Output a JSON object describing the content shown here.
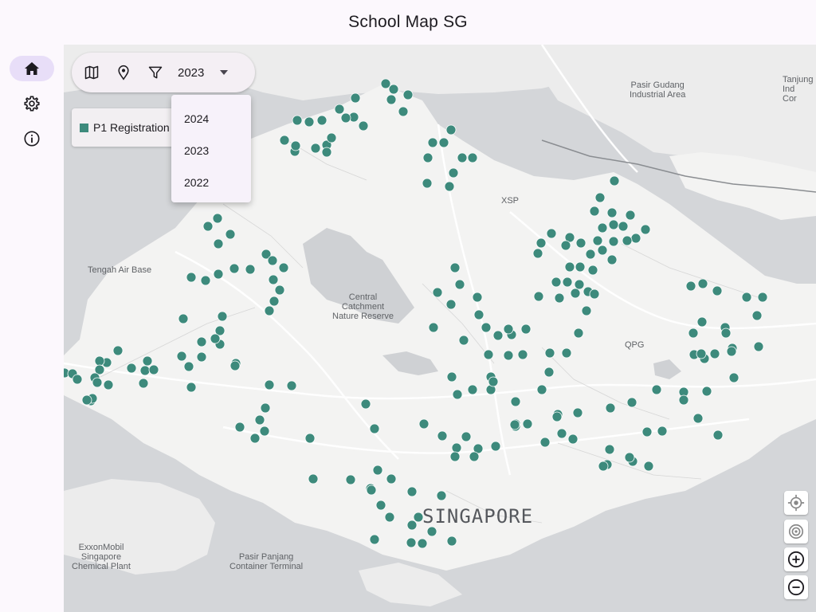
{
  "app": {
    "title": "School Map SG"
  },
  "rail": {
    "items": [
      {
        "name": "home",
        "icon": "home-icon",
        "active": true
      },
      {
        "name": "settings",
        "icon": "gear-icon",
        "active": false
      },
      {
        "name": "about",
        "icon": "info-icon",
        "active": false
      }
    ]
  },
  "toolbar": {
    "icons": [
      "map-icon",
      "location-pin-icon",
      "filter-icon"
    ],
    "year_selected": "2023",
    "year_options": [
      "2024",
      "2023",
      "2022"
    ]
  },
  "legend": {
    "label": "P1 Registration",
    "color": "#3d8a7c"
  },
  "map": {
    "labels": {
      "pasir_gudang": "Pasir Gudang\nIndustrial Area",
      "tanjung": "Tanjung\nInd\nCor",
      "xsp": "XSP",
      "tengah": "Tengah Air Base",
      "catchment": "Central\nCatchment\nNature Reserve",
      "qpg": "QPG",
      "singapore": "SINGAPORE",
      "exxon": "ExxonMobil\nSingapore\nChemical Plant",
      "pasir_panjang": "Pasir Panjang\nContainer Terminal"
    },
    "marker_color": "#3d8a7c",
    "water_color": "#c8cacd",
    "land_color": "#f3f3f2",
    "controls": [
      "my-location-icon",
      "compass-icon",
      "zoom-in-icon",
      "zoom-out-icon"
    ]
  }
}
